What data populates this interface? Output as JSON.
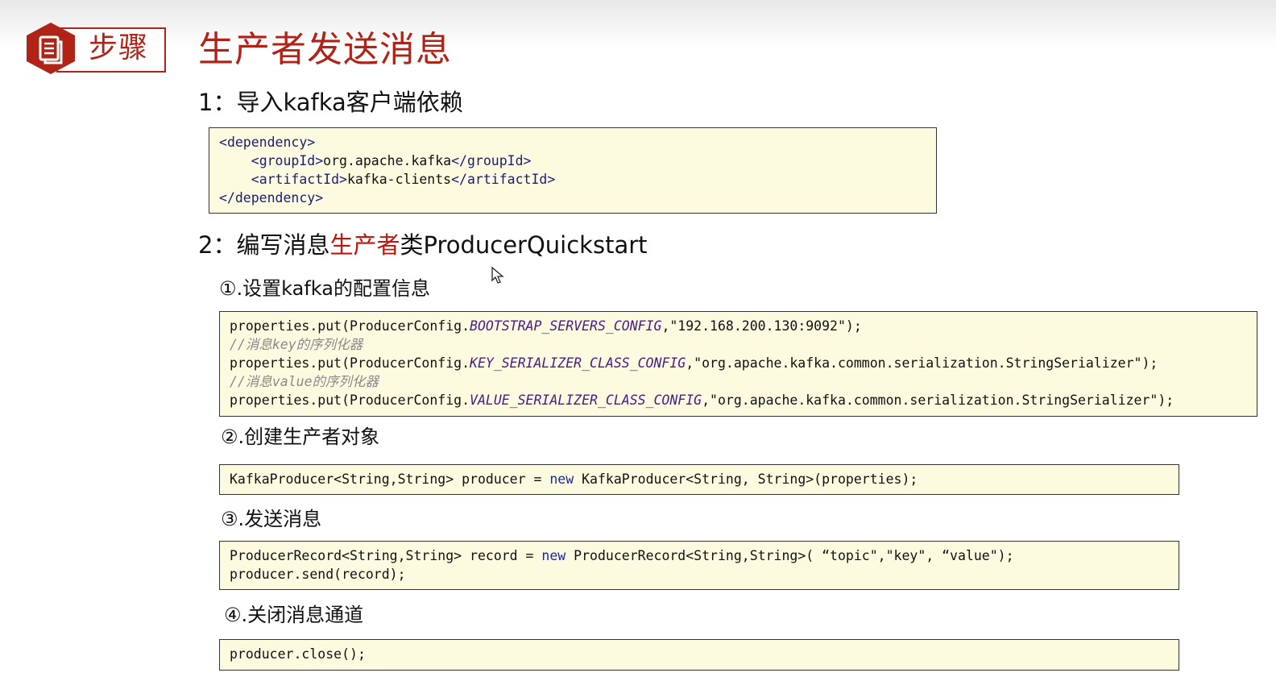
{
  "badge": {
    "icon": "document-icon",
    "label": "步骤"
  },
  "title": "生产者发送消息",
  "step1": {
    "heading": "1：导入kafka客户端依赖",
    "code": {
      "dep_open": "dependency",
      "groupId_tag": "groupId",
      "groupId_value": "org.apache.kafka",
      "artifactId_tag": "artifactId",
      "artifactId_value": "kafka-clients",
      "dep_close": "dependency"
    }
  },
  "step2": {
    "heading_prefix": "2：编写消息",
    "heading_highlight": "生产者",
    "heading_suffix": "类ProducerQuickstart",
    "sub1": {
      "heading": "①.设置kafka的配置信息",
      "line1_prefix": "properties.put(ProducerConfig.",
      "line1_const": "BOOTSTRAP_SERVERS_CONFIG",
      "line1_value": ",\"192.168.200.130:9092\");",
      "comment1": "//消息key的序列化器",
      "line2_prefix": "properties.put(ProducerConfig.",
      "line2_const": "KEY_SERIALIZER_CLASS_CONFIG",
      "line2_value": ",\"org.apache.kafka.common.serialization.StringSerializer\");",
      "comment2": "//消息value的序列化器",
      "line3_prefix": "properties.put(ProducerConfig.",
      "line3_const": "VALUE_SERIALIZER_CLASS_CONFIG",
      "line3_value": ",\"org.apache.kafka.common.serialization.StringSerializer\");"
    },
    "sub2": {
      "heading": "②.创建生产者对象",
      "code_a": "KafkaProducer<String,String> producer = ",
      "code_kw": "new",
      "code_b": " KafkaProducer<String, String>(properties);"
    },
    "sub3": {
      "heading": "③.发送消息",
      "line1_a": "ProducerRecord<String,String> record = ",
      "line1_kw": "new",
      "line1_b": " ProducerRecord<String,String>( “topic\",\"key\", “value\");",
      "line2": "producer.send(record);"
    },
    "sub4": {
      "heading": "④.关闭消息通道",
      "code": "producer.close();"
    }
  },
  "colors": {
    "accent_red": "#b02418",
    "code_background": "#fcfbe0"
  }
}
